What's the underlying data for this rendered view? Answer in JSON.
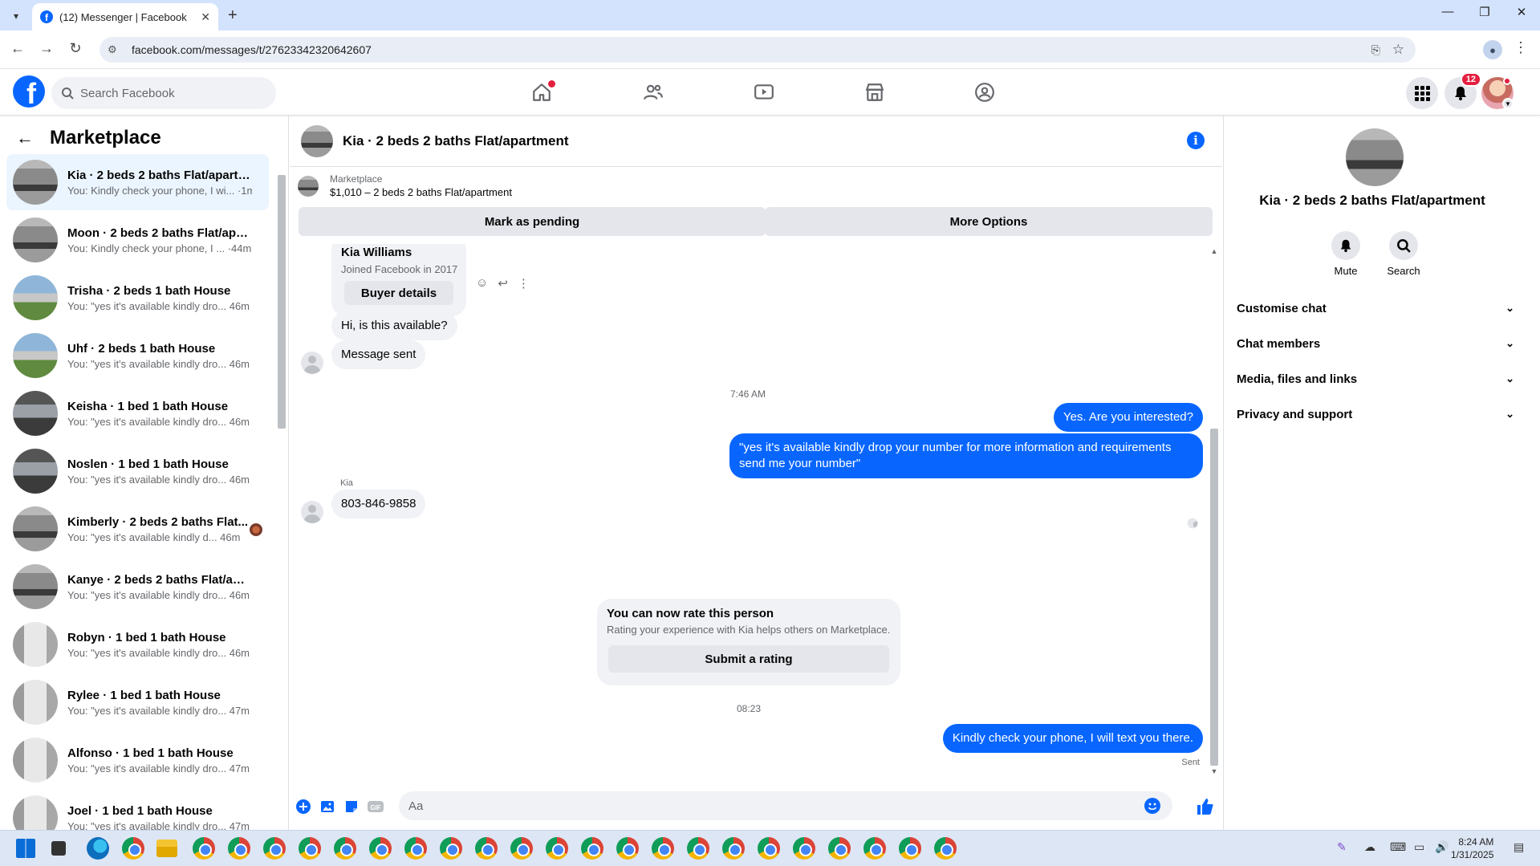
{
  "browser": {
    "tab_title": "(12) Messenger | Facebook",
    "url": "facebook.com/messages/t/27623342320642607"
  },
  "fb": {
    "search_placeholder": "Search Facebook",
    "notification_count": "12"
  },
  "left": {
    "title": "Marketplace",
    "conversations": [
      {
        "name": "Kia · 2 beds 2 baths Flat/apartm...",
        "preview": "You: Kindly check your phone, I wi... ·1m",
        "thumb": "t-interior",
        "active": true
      },
      {
        "name": "Moon · 2 beds 2 baths Flat/apar...",
        "preview": "You: Kindly check your phone, I ... ·44m",
        "thumb": "t-interior"
      },
      {
        "name": "Trisha · 2 beds 1 bath House",
        "preview": "You: \"yes it's available kindly dro...  46m",
        "thumb": "t-house"
      },
      {
        "name": "Uhf · 2 beds 1 bath House",
        "preview": "You: \"yes it's available kindly dro...  46m",
        "thumb": "t-house"
      },
      {
        "name": "Keisha · 1 bed 1 bath House",
        "preview": "You: \"yes it's available kindly dro...  46m",
        "thumb": "t-dark"
      },
      {
        "name": "Noslen · 1 bed 1 bath House",
        "preview": "You: \"yes it's available kindly dro...  46m",
        "thumb": "t-dark"
      },
      {
        "name": "Kimberly · 2 beds 2 baths Flat...",
        "preview": "You: \"yes it's available kindly d...  46m",
        "thumb": "t-interior",
        "mini_avatar": true
      },
      {
        "name": "Kanye · 2 beds 2 baths Flat/apar...",
        "preview": "You: \"yes it's available kindly dro...  46m",
        "thumb": "t-interior"
      },
      {
        "name": "Robyn · 1 bed 1 bath House",
        "preview": "You: \"yes it's available kindly dro...  46m",
        "thumb": "t-white"
      },
      {
        "name": "Rylee · 1 bed 1 bath House",
        "preview": "You: \"yes it's available kindly dro...  47m",
        "thumb": "t-white"
      },
      {
        "name": "Alfonso · 1 bed 1 bath House",
        "preview": "You: \"yes it's available kindly dro...  47m",
        "thumb": "t-white"
      },
      {
        "name": "Joel · 1 bed 1 bath House",
        "preview": "You: \"yes it's available kindly dro...  47m",
        "thumb": "t-white"
      }
    ]
  },
  "chat": {
    "title": "Kia · 2 beds 2 baths Flat/apartment",
    "listing_category": "Marketplace",
    "listing_price": "$1,010 – 2 beds 2 baths Flat/apartment",
    "mark_pending": "Mark as pending",
    "more_options": "More Options",
    "buyer_name": "Kia Williams",
    "buyer_joined": "Joined Facebook in 2017",
    "buyer_details": "Buyer details",
    "msg_available": "Hi, is this available?",
    "msg_sent_notice": "Message sent",
    "time_1": "7:46 AM",
    "out_1": "Yes. Are you interested?",
    "out_2": "\"yes it's available kindly drop your number for more information and requirements send me your number\"",
    "sender_label": "Kia",
    "in_phone": "803-846-9858",
    "rate_heading": "You can now rate this person",
    "rate_sub": "Rating your experience with Kia helps others on Marketplace.",
    "rate_button": "Submit a rating",
    "time_2": "08:23",
    "out_3": "Kindly check your phone, I will text you there.",
    "status": "Sent",
    "composer_placeholder": "Aa"
  },
  "right": {
    "title": "Kia · 2 beds 2 baths Flat/apartment",
    "mute": "Mute",
    "search": "Search",
    "sections": [
      "Customise chat",
      "Chat members",
      "Media, files and links",
      "Privacy and support"
    ]
  },
  "taskbar": {
    "time": "8:24 AM",
    "date": "1/31/2025"
  },
  "colors": {
    "brand": "#0866ff",
    "badge": "#e41e3f",
    "active_row": "#ebf5ff"
  }
}
